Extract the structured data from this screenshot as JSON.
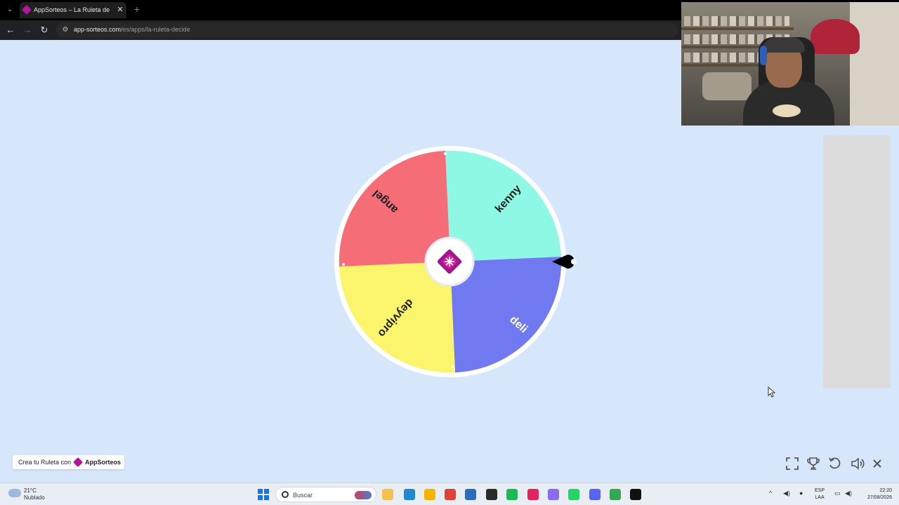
{
  "browser": {
    "tab_title": "AppSorteos – La Ruleta de la Suerte",
    "url_host": "app-sorteos.com",
    "url_path": "/es/apps/la-ruleta-decide"
  },
  "wheel": {
    "segments": [
      {
        "label": "kenny",
        "color": "#8ef8e4"
      },
      {
        "label": "deli",
        "color": "#7079f0"
      },
      {
        "label": "deyvipro",
        "color": "#fbf56e"
      },
      {
        "label": "angel",
        "color": "#f56d77"
      }
    ],
    "center_icon": "appsorteos-logo-icon",
    "pointer_icon": "pointer-pin-icon"
  },
  "footer": {
    "badge_text": "Crea tu Ruleta con",
    "brand_name": "AppSorteos",
    "controls": [
      "fullscreen-icon",
      "trophy-icon",
      "reset-icon",
      "volume-icon",
      "close-icon"
    ]
  },
  "taskbar": {
    "temperature": "21°C",
    "weather": "Nublado",
    "search_placeholder": "Buscar",
    "lang_line1": "ESP",
    "lang_line2": "LAA",
    "time": "22:20",
    "date": "27/08/2026",
    "apps": [
      {
        "name": "file-explorer-icon",
        "color": "#f2c14e"
      },
      {
        "name": "edge-icon",
        "color": "#1f8ad2"
      },
      {
        "name": "folder-icon",
        "color": "#f5b400"
      },
      {
        "name": "chrome-icon",
        "color": "#db4437"
      },
      {
        "name": "store-icon",
        "color": "#2a6ebb"
      },
      {
        "name": "steam-icon",
        "color": "#2b2b2b"
      },
      {
        "name": "spotify-icon",
        "color": "#1db954"
      },
      {
        "name": "tiktok-icon",
        "color": "#e0245e"
      },
      {
        "name": "game-icon",
        "color": "#8a6cf0"
      },
      {
        "name": "whatsapp-icon",
        "color": "#25d366"
      },
      {
        "name": "discord-icon",
        "color": "#5865f2"
      },
      {
        "name": "chrome-alt-icon",
        "color": "#34a853"
      },
      {
        "name": "capcut-icon",
        "color": "#111111"
      }
    ]
  }
}
